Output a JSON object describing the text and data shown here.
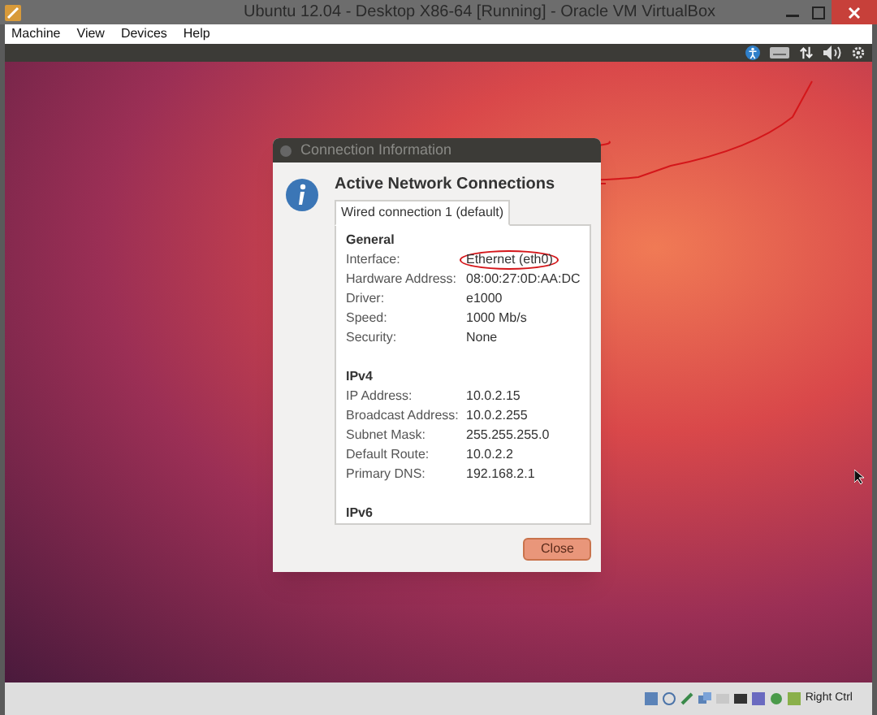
{
  "window": {
    "title": "Ubuntu 12.04 - Desktop X86-64 [Running] - Oracle VM VirtualBox"
  },
  "menu": [
    "Machine",
    "View",
    "Devices",
    "Help"
  ],
  "dialog": {
    "title": "Connection Information",
    "heading": "Active Network Connections",
    "tabs": [
      {
        "label": "Wired connection 1 (default)",
        "selected": true
      }
    ],
    "sections": [
      {
        "title": "General",
        "rows": [
          {
            "label": "Interface:",
            "value": "Ethernet (eth0)",
            "circled": true
          },
          {
            "label": "Hardware Address:",
            "value": "08:00:27:0D:AA:DC",
            "circled": false
          },
          {
            "label": "Driver:",
            "value": "e1000",
            "circled": false
          },
          {
            "label": "Speed:",
            "value": "1000 Mb/s",
            "circled": false
          },
          {
            "label": "Security:",
            "value": "None",
            "circled": false
          }
        ]
      },
      {
        "title": "IPv4",
        "rows": [
          {
            "label": "IP Address:",
            "value": "10.0.2.15",
            "circled": false
          },
          {
            "label": "Broadcast Address:",
            "value": "10.0.2.255",
            "circled": false
          },
          {
            "label": "Subnet Mask:",
            "value": "255.255.255.0",
            "circled": false
          },
          {
            "label": "Default Route:",
            "value": "10.0.2.2",
            "circled": false
          },
          {
            "label": "Primary DNS:",
            "value": "192.168.2.1",
            "circled": false
          }
        ]
      },
      {
        "title": "IPv6"
      }
    ],
    "close_button": "Close"
  },
  "status_bar": {
    "host_key": "Right Ctrl"
  }
}
